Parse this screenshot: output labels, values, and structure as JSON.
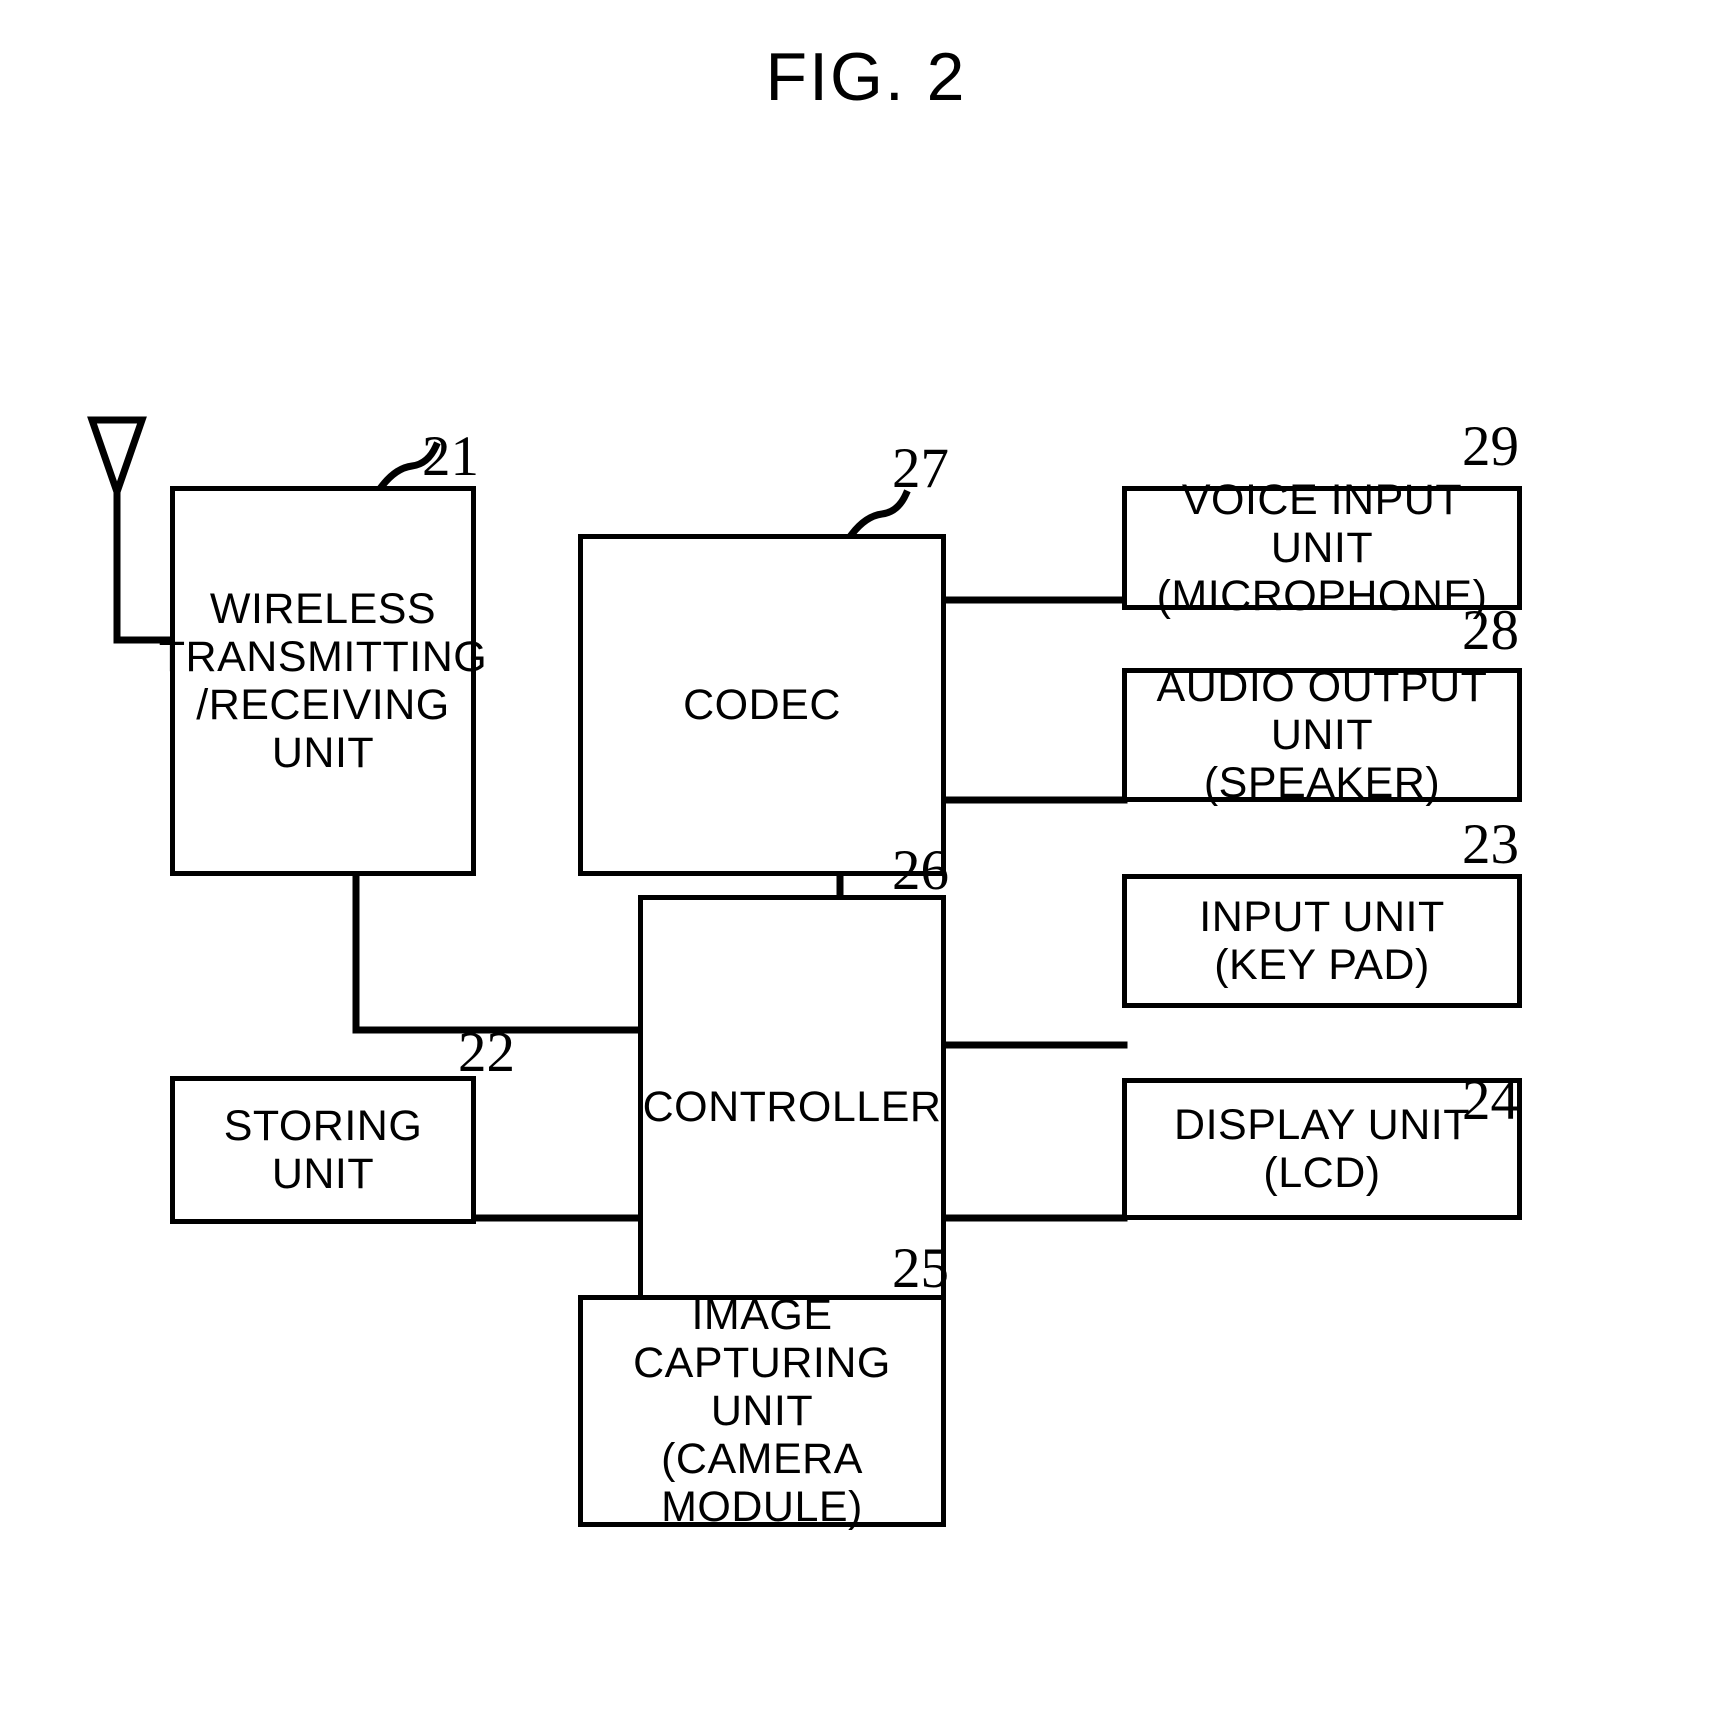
{
  "figure": {
    "title": "FIG. 2",
    "kind": "patent-block-diagram",
    "line_color": "#000000",
    "background_color": "#ffffff"
  },
  "nodes": {
    "wireless": {
      "label": "WIRELESS\nTRANSMITTING\n/RECEIVING\nUNIT",
      "ref": "21"
    },
    "storing": {
      "label": "STORING UNIT",
      "ref": "22"
    },
    "input": {
      "label": "INPUT UNIT\n(KEY PAD)",
      "ref": "23"
    },
    "display": {
      "label": "DISPLAY UNIT\n(LCD)",
      "ref": "24"
    },
    "camera": {
      "label": "IMAGE\nCAPTURING UNIT\n(CAMERA MODULE)",
      "ref": "25"
    },
    "controller": {
      "label": "CONTROLLER",
      "ref": "26"
    },
    "codec": {
      "label": "CODEC",
      "ref": "27"
    },
    "speaker": {
      "label": "AUDIO OUTPUT UNIT\n(SPEAKER)",
      "ref": "28"
    },
    "microphone": {
      "label": "VOICE INPUT UNIT\n(MICROPHONE)",
      "ref": "29"
    }
  },
  "antenna": {
    "name": "antenna"
  },
  "connections": [
    {
      "from": "antenna",
      "to": "wireless"
    },
    {
      "from": "wireless",
      "to": "controller"
    },
    {
      "from": "codec",
      "to": "controller"
    },
    {
      "from": "codec",
      "to": "microphone"
    },
    {
      "from": "codec",
      "to": "speaker"
    },
    {
      "from": "controller",
      "to": "input"
    },
    {
      "from": "controller",
      "to": "display"
    },
    {
      "from": "controller",
      "to": "storing"
    },
    {
      "from": "controller",
      "to": "camera"
    }
  ]
}
